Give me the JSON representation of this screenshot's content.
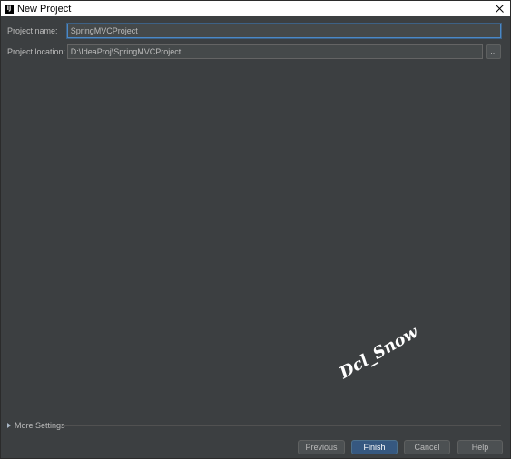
{
  "window": {
    "title": "New Project",
    "app_icon": "intellij-idea-icon",
    "app_icon_text": "IJ"
  },
  "form": {
    "project_name_label": "Project name:",
    "project_name_value": "SpringMVCProject",
    "project_location_label": "Project location:",
    "project_location_value": "D:\\IdeaProj\\SpringMVCProject",
    "browse_label": "..."
  },
  "more_settings": {
    "label": "More Settings"
  },
  "buttons": {
    "previous": "Previous",
    "finish": "Finish",
    "cancel": "Cancel",
    "help": "Help"
  },
  "watermark": {
    "text": "Dcl_Snow"
  },
  "colors": {
    "background": "#3c3f41",
    "accent": "#365880",
    "focus_border": "#4a88c7",
    "text": "#bbbbbb"
  }
}
